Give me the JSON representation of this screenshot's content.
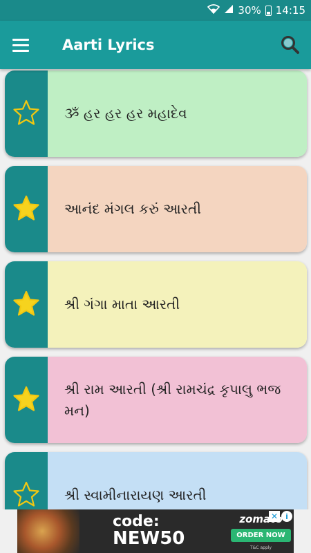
{
  "status_bar": {
    "battery_text": "30%",
    "time": "14:15"
  },
  "app_bar": {
    "title": "Aarti Lyrics",
    "menu_icon": "hamburger-menu-icon",
    "search_icon": "search-icon"
  },
  "colors": {
    "accent": "#1a9b9b",
    "star_outline": "#f2c811",
    "star_fill": "#f6d31e"
  },
  "items": [
    {
      "title": "ૐ હર હર હર મહાદેવ",
      "favorite": false,
      "bg": "#bfefc4"
    },
    {
      "title": "આનંદ મંગલ કરું આરતી",
      "favorite": true,
      "bg": "#f4d5c0"
    },
    {
      "title": "શ્રી ગંગા માતા આરતી",
      "favorite": true,
      "bg": "#f4f2bb"
    },
    {
      "title": "શ્રી રામ આરતી (શ્રી રામચંદ્ર કૃપાલુ ભજ મન)",
      "favorite": true,
      "bg": "#f2c1d5"
    },
    {
      "title": "શ્રી સ્વામીનારાયણ આરતી",
      "favorite": false,
      "bg": "#c4dff5"
    }
  ],
  "ad": {
    "code_line1": "code:",
    "code_line2": "NEW50",
    "brand": "zomato",
    "cta": "ORDER NOW",
    "tc": "T&C apply",
    "adchoice_label": "i",
    "close_label": "✕"
  }
}
